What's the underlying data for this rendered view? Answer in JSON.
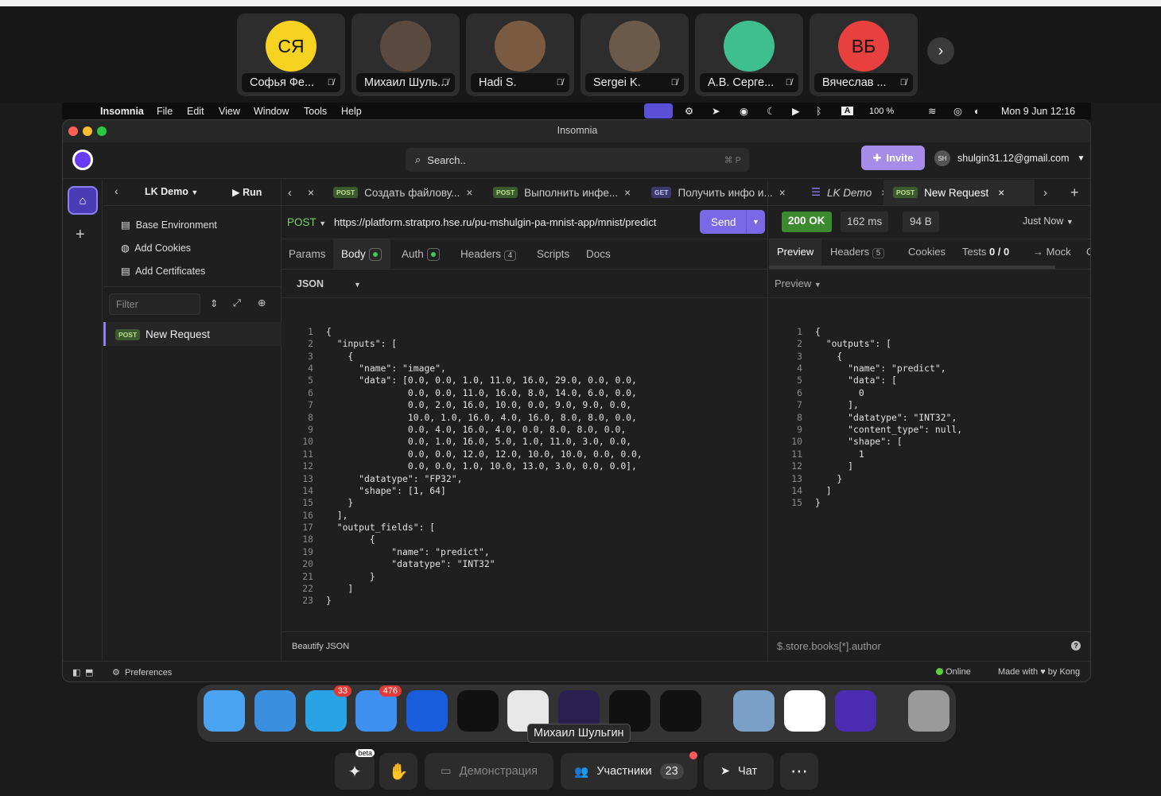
{
  "call": {
    "participants": [
      {
        "initials": "СЯ",
        "name": "Софья Фе...",
        "color": "#f5d320"
      },
      {
        "initials": "",
        "name": "Михаил Шуль...",
        "color": "#5a4a40"
      },
      {
        "initials": "",
        "name": "Hadi S.",
        "color": "#7a5a40"
      },
      {
        "initials": "",
        "name": "Sergei K.",
        "color": "#6b5a4a"
      },
      {
        "initials": "",
        "name": "А.В. Серге...",
        "color": "#3fbf8f"
      },
      {
        "initials": "ВБ",
        "name": "Вячеслав ...",
        "color": "#e83f3f"
      }
    ],
    "next_icon": "chevron-right-icon",
    "muted_icon": "mic-off-icon"
  },
  "menubar": {
    "apple": "",
    "items": [
      "Insomnia",
      "File",
      "Edit",
      "View",
      "Window",
      "Tools",
      "Help"
    ],
    "battery": "100 %",
    "datetime": "Mon 9 Jun  12:16"
  },
  "window": {
    "title": "Insomnia"
  },
  "header": {
    "search_placeholder": "Search..",
    "search_shortcut": "⌘ P",
    "invite_label": "Invite",
    "account_initials": "SH",
    "account_email": "shulgin31.12@gmail.com"
  },
  "sidebar": {
    "collection": "LK Demo",
    "run_label": "Run",
    "items": [
      "Base Environment",
      "Add Cookies",
      "Add Certificates"
    ],
    "filter_placeholder": "Filter",
    "requests": [
      {
        "method": "POST",
        "name": "New Request"
      }
    ]
  },
  "tabs": [
    {
      "method": "POST",
      "label": "Создать файлову..."
    },
    {
      "method": "POST",
      "label": "Выполнить инфе..."
    },
    {
      "method": "GET",
      "label": "Получить инфо и..."
    },
    {
      "method": "",
      "label": "LK Demo"
    },
    {
      "method": "POST",
      "label": "New Request"
    }
  ],
  "request": {
    "method": "POST",
    "url": "https://platform.stratpro.hse.ru/pu-mshulgin-pa-mnist-app/mnist/predict",
    "send_label": "Send",
    "subtabs": [
      "Params",
      "Body",
      "Auth",
      "Headers",
      "Scripts",
      "Docs"
    ],
    "headers_count": "4",
    "body_format": "JSON",
    "beautify_label": "Beautify JSON",
    "body_lines": [
      "{",
      "  \"inputs\": [",
      "    {",
      "      \"name\": \"image\",",
      "      \"data\": [0.0, 0.0, 1.0, 11.0, 16.0, 29.0, 0.0, 0.0,",
      "               0.0, 0.0, 11.0, 16.0, 8.0, 14.0, 6.0, 0.0,",
      "               0.0, 2.0, 16.0, 10.0, 0.0, 9.0, 9.0, 0.0,",
      "               10.0, 1.0, 16.0, 4.0, 16.0, 8.0, 8.0, 0.0,",
      "               0.0, 4.0, 16.0, 4.0, 0.0, 8.0, 8.0, 0.0,",
      "               0.0, 1.0, 16.0, 5.0, 1.0, 11.0, 3.0, 0.0,",
      "               0.0, 0.0, 12.0, 12.0, 10.0, 10.0, 0.0, 0.0,",
      "               0.0, 0.0, 1.0, 10.0, 13.0, 3.0, 0.0, 0.0],",
      "      \"datatype\": \"FP32\",",
      "      \"shape\": [1, 64]",
      "    }",
      "  ],",
      "  \"output_fields\": [",
      "        {",
      "            \"name\": \"predict\",",
      "            \"datatype\": \"INT32\"",
      "        }",
      "    ]",
      "}"
    ]
  },
  "response": {
    "status": "200 OK",
    "time": "162 ms",
    "size": "94 B",
    "when": "Just Now",
    "subtabs": [
      "Preview",
      "Headers",
      "Cookies",
      "Tests",
      "→ Mock",
      "C"
    ],
    "headers_count": "5",
    "tests": "0 / 0",
    "preview_label": "Preview",
    "filter_placeholder": "$.store.books[*].author",
    "body_lines": [
      "{",
      "  \"outputs\": [",
      "    {",
      "      \"name\": \"predict\",",
      "      \"data\": [",
      "        0",
      "      ],",
      "      \"datatype\": \"INT32\",",
      "      \"content_type\": null,",
      "      \"shape\": [",
      "        1",
      "      ]",
      "    }",
      "  ]",
      "}"
    ]
  },
  "statusbar": {
    "preferences": "Preferences",
    "online": "Online",
    "made_with": "Made with ♥ by Kong"
  },
  "dock": {
    "apps": [
      {
        "name": "finder-icon",
        "color": "#4aa3f0",
        "badge": ""
      },
      {
        "name": "safari-icon",
        "color": "#3b8fe0",
        "badge": ""
      },
      {
        "name": "telegram-icon",
        "color": "#2aa3e6",
        "badge": "33"
      },
      {
        "name": "mail-icon",
        "color": "#3d8ff0",
        "badge": "476"
      },
      {
        "name": "bitwarden-icon",
        "color": "#175ddc",
        "badge": ""
      },
      {
        "name": "unity-icon",
        "color": "#111111",
        "badge": ""
      },
      {
        "name": "chrome-icon",
        "color": "#e8e8e8",
        "badge": ""
      },
      {
        "name": "obsidian-icon",
        "color": "#2a2050",
        "badge": ""
      },
      {
        "name": "terminal-icon",
        "color": "#111111",
        "badge": ""
      },
      {
        "name": "activity-monitor-icon",
        "color": "#111111",
        "badge": ""
      },
      {
        "name": "preview-icon",
        "color": "#7aa0c8",
        "badge": ""
      },
      {
        "name": "keychain-icon",
        "color": "#ffffff",
        "badge": ""
      },
      {
        "name": "insomnia-icon",
        "color": "#4b2bb0",
        "badge": ""
      },
      {
        "name": "trash-icon",
        "color": "#9a9a9a",
        "badge": ""
      }
    ],
    "tooltip": "Михаил Шульгин"
  },
  "bottom": {
    "beta": "beta",
    "screen_share": "Демонстрация",
    "participants_label": "Участники",
    "participants_count": "23",
    "chat_label": "Чат"
  }
}
